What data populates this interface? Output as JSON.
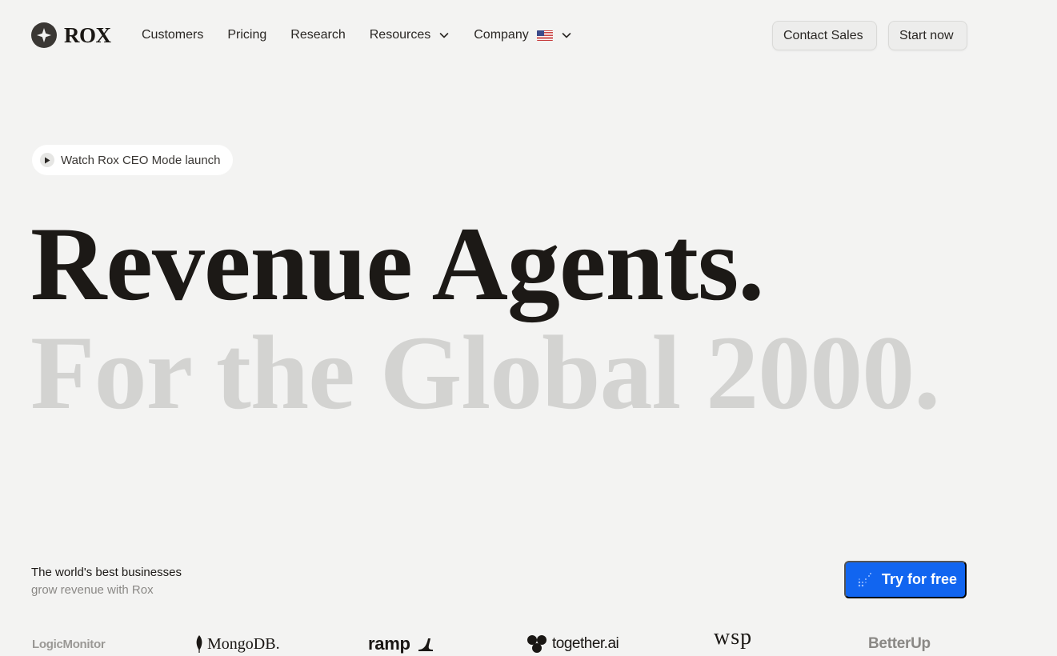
{
  "brand": {
    "name": "ROX"
  },
  "nav": {
    "links": [
      {
        "label": "Customers"
      },
      {
        "label": "Pricing"
      },
      {
        "label": "Research"
      },
      {
        "label": "Resources"
      },
      {
        "label": "Company"
      }
    ],
    "contact_label": "Contact Sales",
    "start_label": "Start now"
  },
  "hero": {
    "watch_label": "Watch Rox CEO Mode launch",
    "headline_1": "Revenue Agents.",
    "headline_2": "For the Global 2000."
  },
  "footer_band": {
    "tagline_1": "The world's best businesses",
    "tagline_2": "grow revenue with Rox",
    "cta_label": "Try for free",
    "customer_logos": [
      {
        "name": "LogicMonitor"
      },
      {
        "name": "MongoDB."
      },
      {
        "name": "ramp"
      },
      {
        "name": "together.ai"
      },
      {
        "name": "wsp"
      },
      {
        "name": "BetterUp"
      }
    ]
  },
  "colors": {
    "background": "#f3f3f2",
    "headline_dark": "#1c1916",
    "headline_light": "#d3d3d1",
    "cta_blue": "#1165f0"
  },
  "icons": {
    "logo": "compass-star-icon",
    "chevron": "chevron-down-icon",
    "flag": "us-flag-icon",
    "play": "play-icon",
    "cta": "sparkle-grid-icon"
  }
}
